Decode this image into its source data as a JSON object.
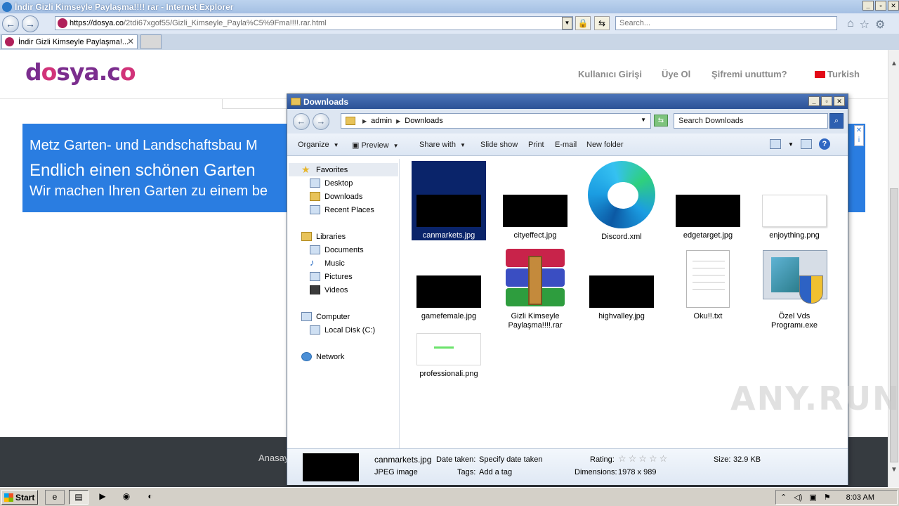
{
  "ie": {
    "title": "İndir Gizli Kimseyle Paylaşma!!!! rar - Internet Explorer",
    "url_host": "https://dosya.co",
    "url_path": "/2tdi67xgof55/Gizli_Kimseyle_Payla%C5%9Fma!!!!.rar.html",
    "search_placeholder": "Search...",
    "tab_label": "İndir Gizli Kimseyle Paylaşma!...",
    "icons": [
      "back-icon",
      "forward-icon",
      "lock-icon",
      "refresh-icon",
      "home-icon",
      "favorites-star-icon",
      "gear-icon"
    ]
  },
  "site": {
    "logo_main": "d",
    "logo_o": "o",
    "logo_rest": "sya.c",
    "logo_end": "o",
    "nav": {
      "login": "Kullanıcı Girişi",
      "register": "Üye Ol",
      "forgot": "Şifremi unuttum?",
      "language": "Turkish"
    },
    "ad": {
      "line1": "Metz Garten- und Landschaftsbau M",
      "line2": "Endlich einen schönen Garten",
      "line3": "Wir machen Ihren Garten zu einem be",
      "close": "✕",
      "info": "i"
    },
    "footer_link": "Anasay",
    "watermark": "ANY.RUN"
  },
  "explorer": {
    "title": "Downloads",
    "breadcrumb": [
      "admin",
      "Downloads"
    ],
    "search_placeholder": "Search Downloads",
    "toolbar": {
      "organize": "Organize",
      "preview": "Preview",
      "share_with": "Share with",
      "slide_show": "Slide show",
      "print": "Print",
      "email": "E-mail",
      "new_folder": "New folder"
    },
    "nav_pane": {
      "favorites": "Favorites",
      "desktop": "Desktop",
      "downloads": "Downloads",
      "recent_places": "Recent Places",
      "libraries": "Libraries",
      "documents": "Documents",
      "music": "Music",
      "pictures": "Pictures",
      "videos": "Videos",
      "computer": "Computer",
      "local_disk": "Local Disk (C:)",
      "network": "Network"
    },
    "files": [
      {
        "name": "canmarkets.jpg",
        "type": "jpg-black"
      },
      {
        "name": "cityeffect.jpg",
        "type": "jpg-black"
      },
      {
        "name": "Discord.xml",
        "type": "edge"
      },
      {
        "name": "edgetarget.jpg",
        "type": "jpg-black"
      },
      {
        "name": "enjoything.png",
        "type": "png-white"
      },
      {
        "name": "gamefemale.jpg",
        "type": "jpg-black"
      },
      {
        "name": "Gizli Kimseyle Paylaşma!!!!.rar",
        "type": "rar"
      },
      {
        "name": "highvalley.jpg",
        "type": "jpg-black"
      },
      {
        "name": "Oku!!.txt",
        "type": "txt"
      },
      {
        "name": "Özel Vds Programı.exe",
        "type": "exe"
      },
      {
        "name": "professionali.png",
        "type": "png-green"
      }
    ],
    "details": {
      "filename": "canmarkets.jpg",
      "filetype": "JPEG image",
      "date_label": "Date taken:",
      "date_value": "Specify date taken",
      "tags_label": "Tags:",
      "tags_value": "Add a tag",
      "rating_label": "Rating:",
      "rating_stars": "☆☆☆☆☆",
      "dimensions_label": "Dimensions:",
      "dimensions_value": "1978 x 989",
      "size_label": "Size:",
      "size_value": "32.9 KB"
    }
  },
  "taskbar": {
    "start": "Start",
    "clock": "8:03 AM"
  }
}
